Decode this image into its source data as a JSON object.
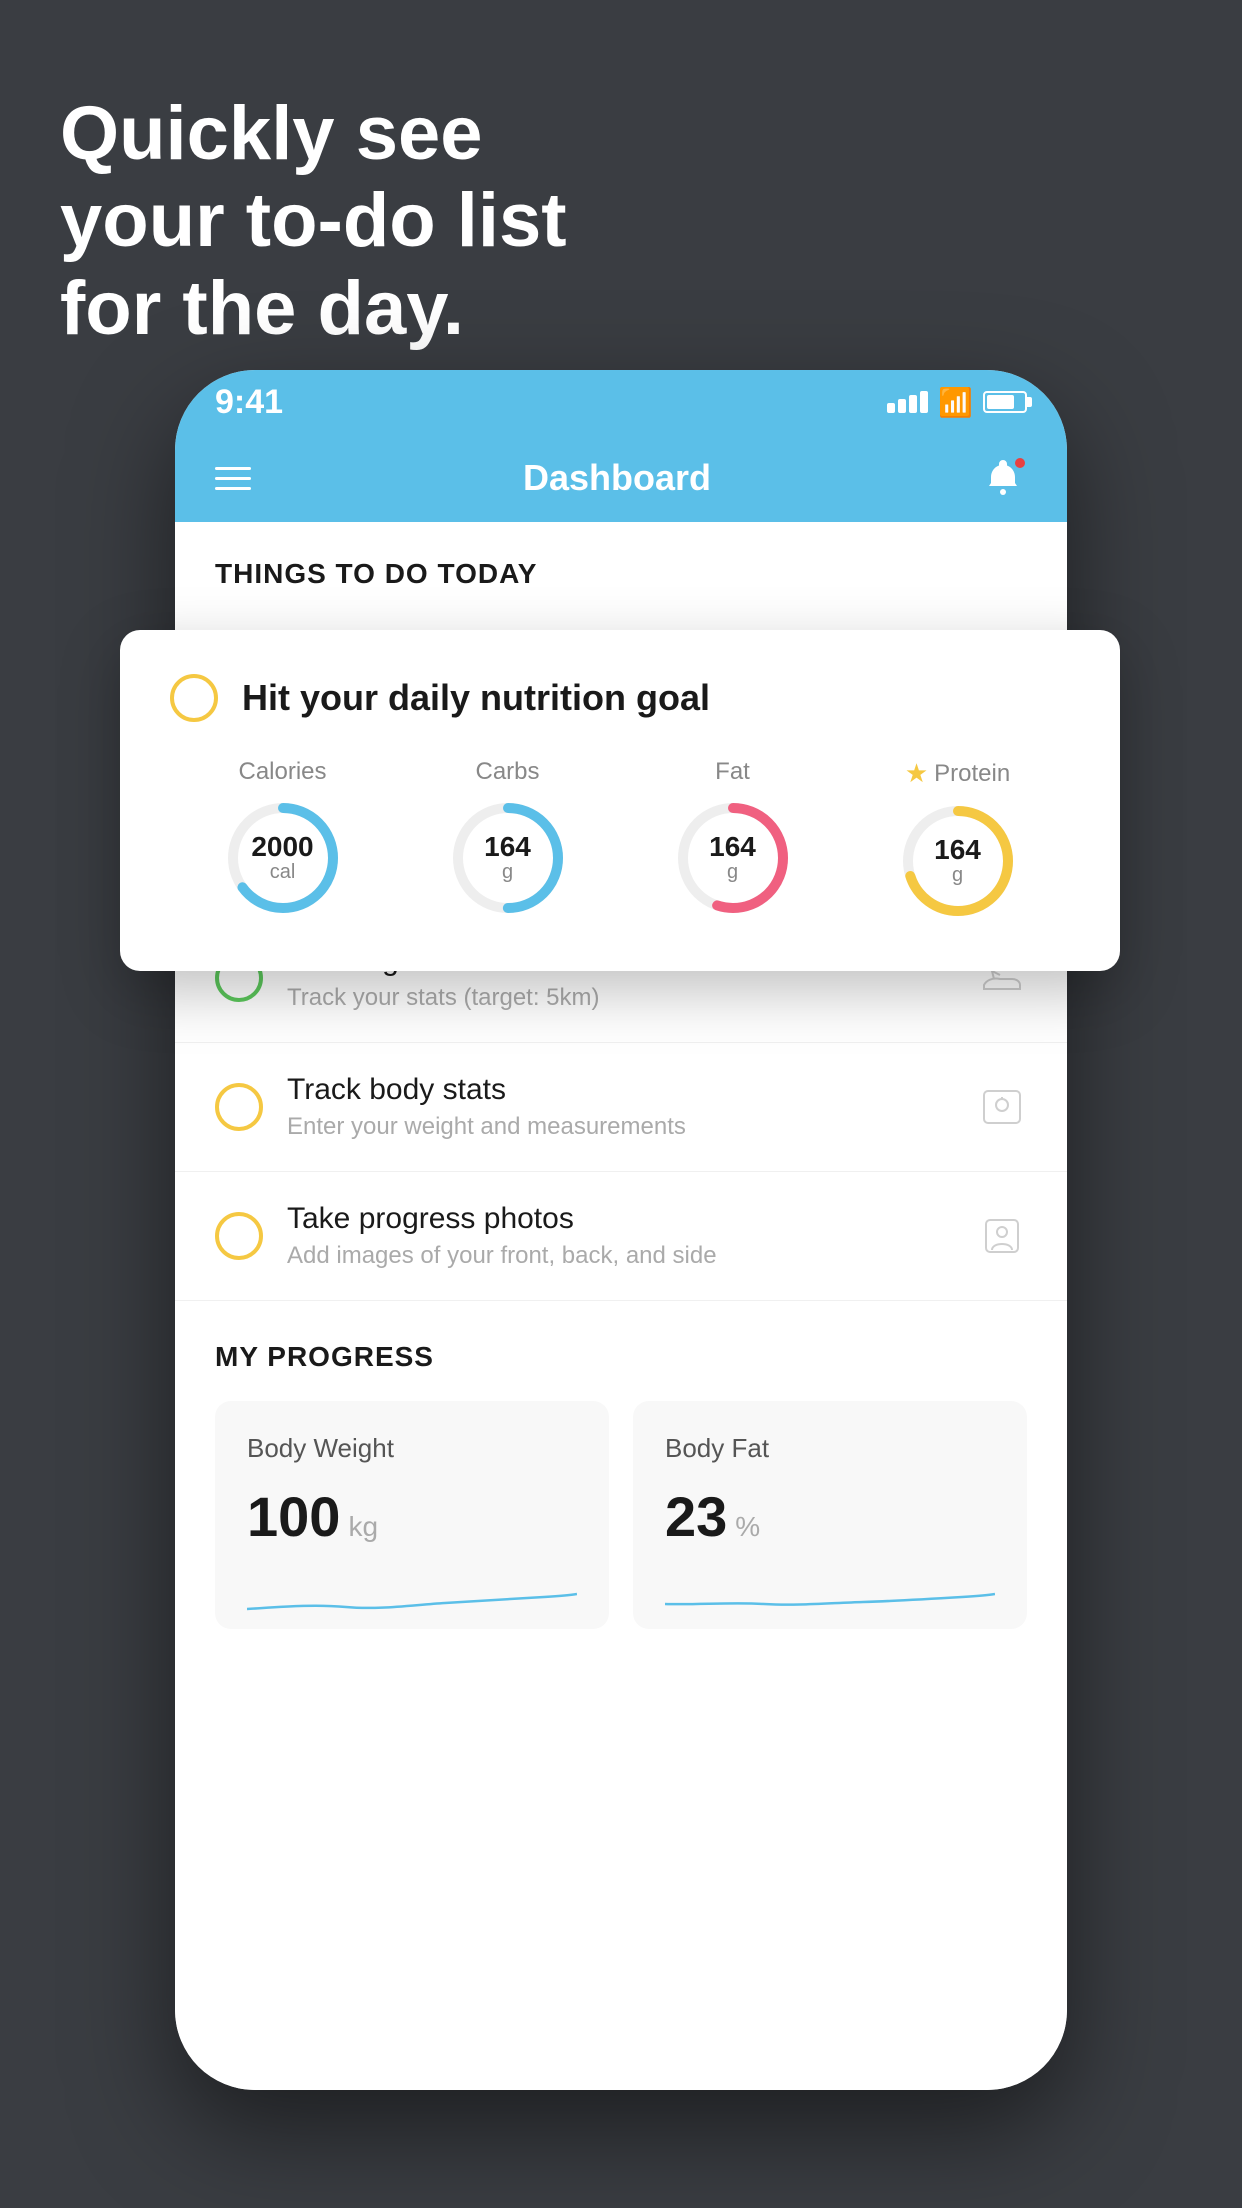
{
  "background": {
    "color": "#3a3d42"
  },
  "hero": {
    "line1": "Quickly see",
    "line2": "your to-do list",
    "line3": "for the day."
  },
  "statusBar": {
    "time": "9:41",
    "backgroundColor": "#5bbfe8"
  },
  "navBar": {
    "title": "Dashboard",
    "backgroundColor": "#5bbfe8"
  },
  "thingsToDoHeader": "THINGS TO DO TODAY",
  "floatingCard": {
    "title": "Hit your daily nutrition goal",
    "checkboxColor": "#f5c842",
    "rings": [
      {
        "label": "Calories",
        "value": "2000",
        "unit": "cal",
        "color": "#5bbfe8",
        "percent": 0.65,
        "starred": false
      },
      {
        "label": "Carbs",
        "value": "164",
        "unit": "g",
        "color": "#5bbfe8",
        "percent": 0.5,
        "starred": false
      },
      {
        "label": "Fat",
        "value": "164",
        "unit": "g",
        "color": "#f06080",
        "percent": 0.55,
        "starred": false
      },
      {
        "label": "Protein",
        "value": "164",
        "unit": "g",
        "color": "#f5c842",
        "percent": 0.7,
        "starred": true
      }
    ]
  },
  "todoItems": [
    {
      "title": "Running",
      "subtitle": "Track your stats (target: 5km)",
      "checkColor": "#5cc85c",
      "icon": "shoe"
    },
    {
      "title": "Track body stats",
      "subtitle": "Enter your weight and measurements",
      "checkColor": "#f5c842",
      "icon": "scale"
    },
    {
      "title": "Take progress photos",
      "subtitle": "Add images of your front, back, and side",
      "checkColor": "#f5c842",
      "icon": "camera"
    }
  ],
  "progressSection": {
    "header": "MY PROGRESS",
    "cards": [
      {
        "title": "Body Weight",
        "value": "100",
        "unit": "kg"
      },
      {
        "title": "Body Fat",
        "value": "23",
        "unit": "%"
      }
    ]
  }
}
